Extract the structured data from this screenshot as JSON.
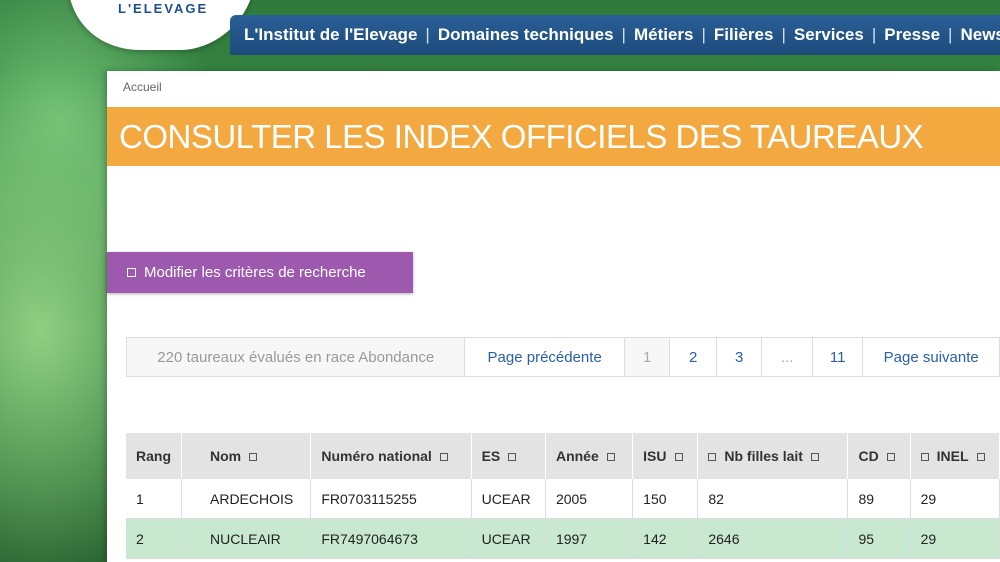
{
  "logo": {
    "text": "L'ELEVAGE"
  },
  "nav": {
    "items": [
      "L'Institut de l'Elevage",
      "Domaines techniques",
      "Métiers",
      "Filières",
      "Services",
      "Presse",
      "Newsle"
    ]
  },
  "breadcrumb": "Accueil",
  "page_title": "CONSULTER LES INDEX OFFICIELS DES TAUREAUX",
  "modify_button": "Modifier les critères de recherche",
  "pager": {
    "count_text": "220 taureaux évalués en race Abondance",
    "prev": "Page précédente",
    "pages": [
      "1",
      "2",
      "3",
      "...",
      "11"
    ],
    "next": "Page suivante"
  },
  "table": {
    "headers": [
      "Rang",
      "Nom",
      "Numéro national",
      "ES",
      "Année",
      "ISU",
      "Nb filles lait",
      "CD",
      "INEL"
    ],
    "rows": [
      [
        "1",
        "ARDECHOIS",
        "FR0703115255",
        "UCEAR",
        "2005",
        "150",
        "82",
        "89",
        "29"
      ],
      [
        "2",
        "NUCLEAIR",
        "FR7497064673",
        "UCEAR",
        "1997",
        "142",
        "2646",
        "95",
        "29"
      ]
    ]
  },
  "colors": {
    "nav_bg": "#1d4b7c",
    "title_bg": "#f4a940",
    "button_bg": "#9d59ae",
    "row_alt": "#c8e8d0"
  }
}
